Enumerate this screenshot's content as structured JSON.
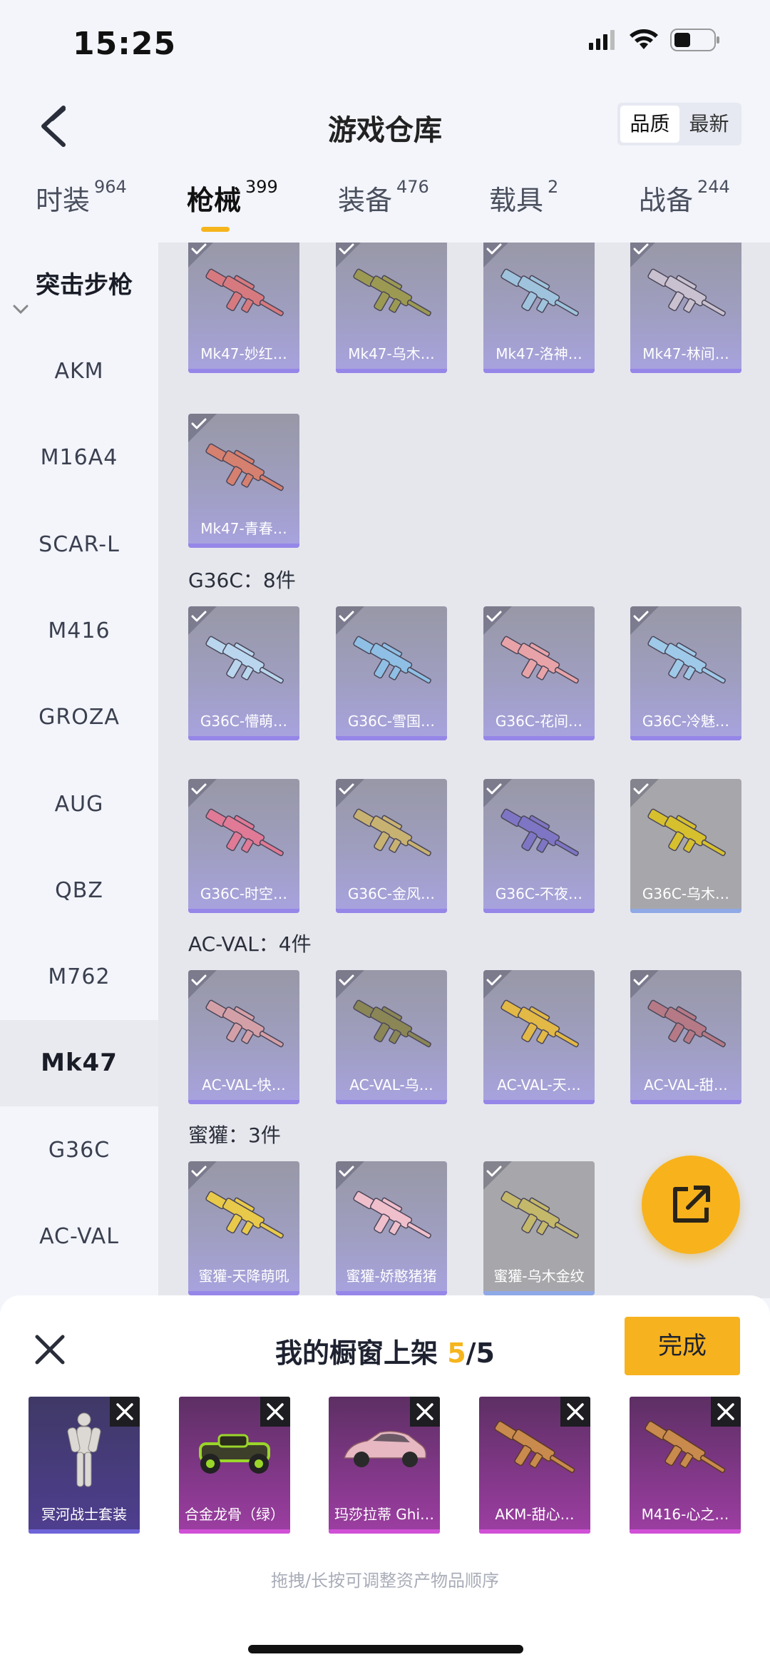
{
  "status_bar": {
    "time": "15:25"
  },
  "header": {
    "title": "游戏仓库",
    "sort_options": [
      "品质",
      "最新"
    ],
    "active_sort": "品质"
  },
  "tabs": [
    {
      "label": "时装",
      "count": "964"
    },
    {
      "label": "枪械",
      "count": "399"
    },
    {
      "label": "装备",
      "count": "476"
    },
    {
      "label": "载具",
      "count": "2"
    },
    {
      "label": "战备",
      "count": "244"
    }
  ],
  "active_tab": "枪械",
  "sidebar": {
    "category": "突击步枪",
    "items": [
      "AKM",
      "M16A4",
      "SCAR-L",
      "M416",
      "GROZA",
      "AUG",
      "QBZ",
      "M762",
      "Mk47",
      "G36C",
      "AC-VAL"
    ],
    "active_item": "Mk47"
  },
  "groups": [
    {
      "title": "",
      "items": [
        {
          "name": "Mk47-妙红…",
          "color": "#d77a80"
        },
        {
          "name": "Mk47-乌木…",
          "color": "#9c9a52"
        },
        {
          "name": "Mk47-洛神…",
          "color": "#9fc3dc"
        },
        {
          "name": "Mk47-林间…",
          "color": "#c9c1cf"
        },
        {
          "name": "Mk47-青春…",
          "color": "#d68070"
        }
      ]
    },
    {
      "title": "G36C：8件",
      "items": [
        {
          "name": "G36C-懵萌…",
          "color": "#b9d6ee"
        },
        {
          "name": "G36C-雪国…",
          "color": "#8fbfe4"
        },
        {
          "name": "G36C-花间…",
          "color": "#e8a3a8"
        },
        {
          "name": "G36C-冷魅…",
          "color": "#9fc9e8"
        },
        {
          "name": "G36C-时空…",
          "color": "#e07a96"
        },
        {
          "name": "G36C-金风…",
          "color": "#c8b272"
        },
        {
          "name": "G36C-不夜…",
          "color": "#7e76c4"
        },
        {
          "name": "G36C-乌木…",
          "color": "#d6c02e"
        }
      ]
    },
    {
      "title": "AC-VAL：4件",
      "items": [
        {
          "name": "AC-VAL-快…",
          "color": "#d4a0a8"
        },
        {
          "name": "AC-VAL-乌…",
          "color": "#8a8656"
        },
        {
          "name": "AC-VAL-天…",
          "color": "#e2b846"
        },
        {
          "name": "AC-VAL-甜…",
          "color": "#b57a86"
        }
      ]
    },
    {
      "title": "蜜獾：3件",
      "items": [
        {
          "name": "蜜獾-天降萌吼",
          "color": "#e8c94a"
        },
        {
          "name": "蜜獾-娇憨猪猪",
          "color": "#f0bfcc"
        },
        {
          "name": "蜜獾-乌木金纹",
          "color": "#c4b86a"
        }
      ]
    }
  ],
  "sheet": {
    "title_prefix": "我的橱窗上架 ",
    "current": "5",
    "total": "/5",
    "done_label": "完成",
    "hint": "拖拽/长按可调整资产物品顺序",
    "slots": [
      {
        "name": "冥河战士套装",
        "type": "costume"
      },
      {
        "name": "合金龙骨（绿）",
        "type": "vehicle"
      },
      {
        "name": "玛莎拉蒂 Ghi…",
        "type": "car"
      },
      {
        "name": "AKM-甜心…",
        "type": "gun"
      },
      {
        "name": "M416-心之…",
        "type": "gun"
      }
    ]
  }
}
